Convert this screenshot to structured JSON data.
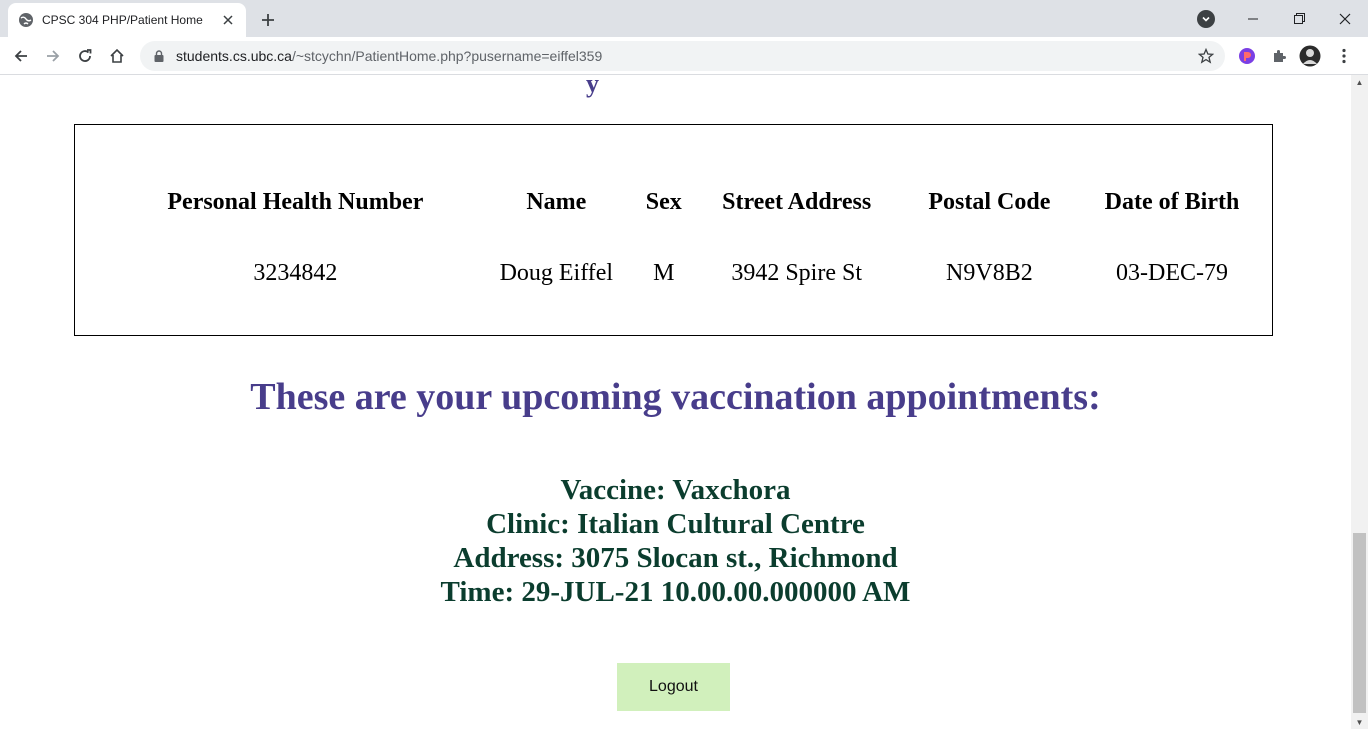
{
  "browser": {
    "tab_title": "CPSC 304 PHP/Patient Home",
    "url_host": "students.cs.ubc.ca",
    "url_path": "/~stcychn/PatientHome.php?pusername=eiffel359"
  },
  "page": {
    "partial_heading_fragment": "y",
    "table": {
      "headers": [
        "Personal Health Number",
        "Name",
        "Sex",
        "Street Address",
        "Postal Code",
        "Date of Birth"
      ],
      "row": [
        "3234842",
        "Doug Eiffel",
        "M",
        "3942 Spire St",
        "N9V8B2",
        "03-DEC-79"
      ]
    },
    "upcoming_heading": "These are your upcoming vaccination appointments:",
    "appointment": {
      "vaccine": "Vaccine: Vaxchora",
      "clinic": "Clinic: Italian Cultural Centre",
      "address": "Address: 3075 Slocan st., Richmond",
      "time": "Time: 29-JUL-21 10.00.00.000000 AM"
    },
    "logout_label": "Logout"
  },
  "icons": {
    "favicon": "globe-icon",
    "tab_close": "close-icon",
    "new_tab": "plus-icon",
    "back": "arrow-left-icon",
    "forward": "arrow-right-icon",
    "reload": "reload-icon",
    "home": "home-icon",
    "lock": "lock-icon",
    "bookmark": "star-icon",
    "extensions": "puzzle-icon"
  }
}
